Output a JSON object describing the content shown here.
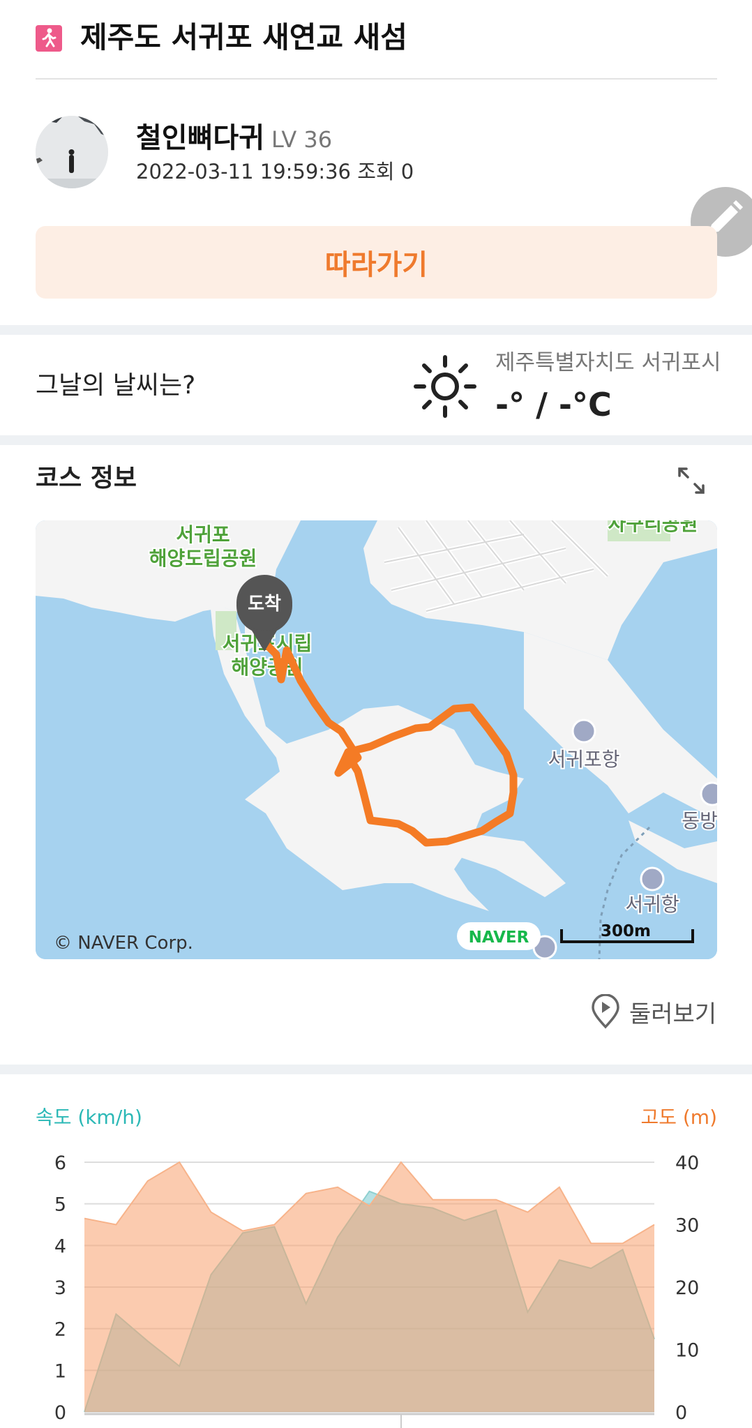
{
  "header": {
    "title": "제주도 서귀포 새연교 새섬",
    "icon": "walking-person-icon",
    "icon_color": "#ee5a8a"
  },
  "profile": {
    "name": "철인뼈다귀",
    "level": "LV 36",
    "datetime": "2022-03-11 19:59:36",
    "views": "조회 0"
  },
  "actions": {
    "follow_label": "따라가기",
    "edit_icon": "pencil-icon",
    "accent": "#ef7a2d"
  },
  "weather": {
    "question": "그날의 날씨는?",
    "location": "제주특별자치도 서귀포시",
    "temperature": "-° / -°C",
    "icon": "sun-icon"
  },
  "course": {
    "title": "코스 정보",
    "expand_icon": "expand-arrows-icon",
    "map": {
      "labels": {
        "park1_line1": "서귀포",
        "park1_line2": "해양도립공원",
        "park2_line1": "서귀포시립",
        "park2_line2": "해양공원",
        "top_right": "자구리공원",
        "port1": "서귀포항",
        "port2": "동방",
        "port3": "서귀항"
      },
      "marker": "도착",
      "copyright": "© NAVER Corp.",
      "naver": "NAVER",
      "scale": "300m",
      "route_color": "#f47b25"
    },
    "look_around": "둘러보기"
  },
  "chart_data": {
    "type": "area",
    "x": [
      0,
      1,
      2,
      3,
      4,
      5,
      6,
      7,
      8,
      9,
      10,
      11,
      12,
      13,
      14,
      15,
      16,
      17,
      18
    ],
    "series": [
      {
        "name": "속도 (km/h)",
        "axis": "left",
        "color": "#2bb8b6",
        "values": [
          0,
          2.35,
          1.7,
          1.1,
          3.3,
          4.3,
          4.45,
          2.6,
          4.2,
          5.3,
          5.0,
          4.9,
          4.6,
          4.85,
          2.4,
          3.65,
          3.45,
          3.9,
          1.75
        ]
      },
      {
        "name": "고도 (m)",
        "axis": "right",
        "color": "#ef7a2d",
        "values": [
          31,
          30,
          37,
          40,
          32,
          29,
          30,
          35,
          36,
          33,
          40,
          34,
          34,
          34,
          32,
          36,
          27,
          27,
          30
        ]
      }
    ],
    "left_axis": {
      "label": "속도 (km/h)",
      "ticks": [
        "0",
        "1",
        "2",
        "3",
        "4",
        "5",
        "6"
      ],
      "ylim": [
        0,
        6
      ]
    },
    "right_axis": {
      "label": "고도 (m)",
      "ticks": [
        "0",
        "10",
        "20",
        "30",
        "40"
      ],
      "ylim": [
        0,
        40
      ]
    },
    "grid": true
  }
}
